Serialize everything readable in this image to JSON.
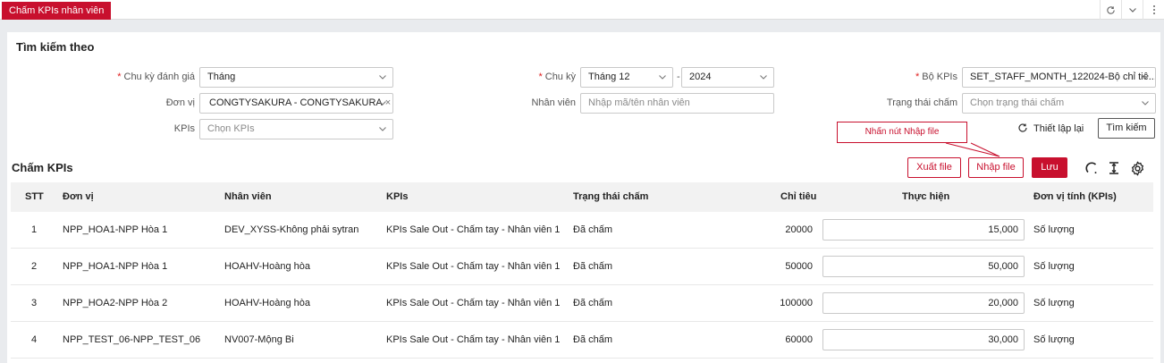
{
  "tab": {
    "label": "Chấm KPIs nhân viên"
  },
  "search": {
    "title": "Tìm kiếm theo",
    "cycle_label": "Chu kỳ đánh giá",
    "cycle_value": "Tháng",
    "period_label": "Chu kỳ",
    "month_value": "Tháng 12",
    "year_value": "2024",
    "kpiset_label": "Bộ KPIs",
    "kpiset_value": "SET_STAFF_MONTH_122024-Bộ chỉ tiê...",
    "unit_label": "Đơn vị",
    "unit_tag": "CONGTYSAKURA - CONGTYSAKURA",
    "employee_label": "Nhân viên",
    "employee_placeholder": "Nhập mã/tên nhân viên",
    "status_label": "Trạng thái chấm",
    "status_placeholder": "Chọn trạng thái chấm",
    "kpis_label": "KPIs",
    "kpis_placeholder": "Chọn KPIs",
    "reset_label": "Thiết lập lại",
    "search_button": "Tìm kiếm"
  },
  "callout": {
    "text": "Nhấn nút Nhập file"
  },
  "grid": {
    "title": "Chấm KPIs",
    "export_button": "Xuất file",
    "import_button": "Nhập file",
    "save_button": "Lưu",
    "columns": [
      "STT",
      "Đơn vị",
      "Nhân viên",
      "KPIs",
      "Trạng thái chấm",
      "Chỉ tiêu",
      "Thực hiện",
      "Đơn vị tính (KPIs)"
    ],
    "rows": [
      {
        "stt": "1",
        "unit": "NPP_HOA1-NPP Hòa 1",
        "employee": "DEV_XYSS-Không phải sytran",
        "kpi": "KPIs Sale Out - Chấm tay - Nhân viên 1",
        "status": "Đã chấm",
        "target": "20000",
        "actual": "15,000",
        "uom": "Số lượng"
      },
      {
        "stt": "2",
        "unit": "NPP_HOA1-NPP Hòa 1",
        "employee": "HOAHV-Hoàng hòa",
        "kpi": "KPIs Sale Out - Chấm tay - Nhân viên 1",
        "status": "Đã chấm",
        "target": "50000",
        "actual": "50,000",
        "uom": "Số lượng"
      },
      {
        "stt": "3",
        "unit": "NPP_HOA2-NPP Hòa 2",
        "employee": "HOAHV-Hoàng hòa",
        "kpi": "KPIs Sale Out - Chấm tay - Nhân viên 1",
        "status": "Đã chấm",
        "target": "100000",
        "actual": "20,000",
        "uom": "Số lượng"
      },
      {
        "stt": "4",
        "unit": "NPP_TEST_06-NPP_TEST_06",
        "employee": "NV007-Mộng Bi",
        "kpi": "KPIs Sale Out - Chấm tay - Nhân viên 1",
        "status": "Đã chấm",
        "target": "60000",
        "actual": "30,000",
        "uom": "Số lượng"
      }
    ]
  },
  "colors": {
    "brand": "#c8102e"
  },
  "icons": [
    "refresh-icon",
    "chevron-down-icon",
    "reset-icon",
    "reload-icon",
    "column-height-icon",
    "settings-icon"
  ]
}
